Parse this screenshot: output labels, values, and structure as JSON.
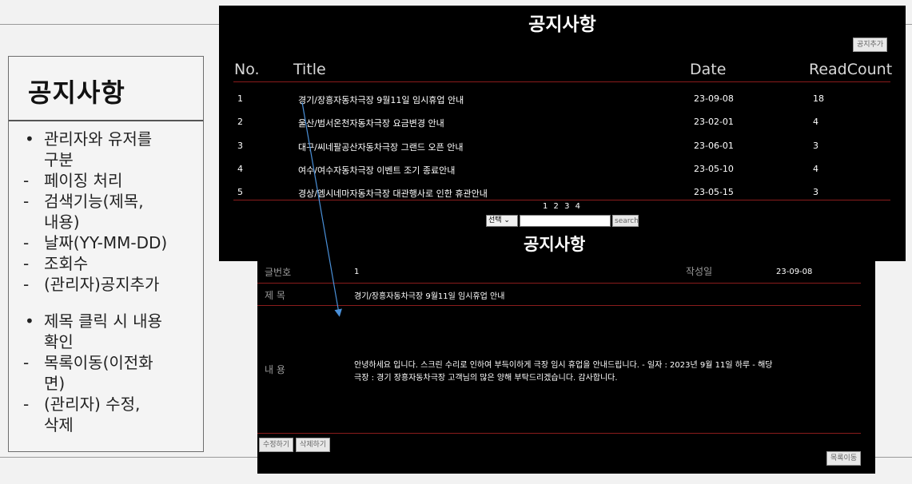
{
  "note": {
    "title": "공지사항",
    "items": [
      {
        "type": "bullet",
        "text": "관리자와 유저를"
      },
      {
        "type": "cont",
        "text": "구분"
      },
      {
        "type": "dash",
        "text": "페이징 처리"
      },
      {
        "type": "dash",
        "text": "검색기능(제목,"
      },
      {
        "type": "cont",
        "text": "내용)"
      },
      {
        "type": "dash",
        "text": "날짜(YY-MM-DD)"
      },
      {
        "type": "dash",
        "text": "조회수"
      },
      {
        "type": "dash",
        "text": "(관리자)공지추가"
      },
      {
        "type": "gap",
        "text": ""
      },
      {
        "type": "bullet",
        "text": "제목 클릭 시 내용"
      },
      {
        "type": "cont",
        "text": "확인"
      },
      {
        "type": "dash",
        "text": "목록이동(이전화"
      },
      {
        "type": "cont",
        "text": "면)"
      },
      {
        "type": "dash",
        "text": "(관리자) 수정,"
      },
      {
        "type": "cont",
        "text": "삭제"
      }
    ]
  },
  "list": {
    "heading": "공지사항",
    "add_button": "공지추가",
    "columns": {
      "no": "No.",
      "title": "Title",
      "date": "Date",
      "readcount": "ReadCount"
    },
    "rows": [
      {
        "no": "1",
        "title": "경기/장흥자동차극장 9월11일 임시휴업 안내",
        "date": "23-09-08",
        "count": "18"
      },
      {
        "no": "2",
        "title": "울산/범서온천자동차극장 요금변경 안내",
        "date": "23-02-01",
        "count": "4"
      },
      {
        "no": "3",
        "title": "대구/씨네팔공산자동차극장 그랜드 오픈 안내",
        "date": "23-06-01",
        "count": "3"
      },
      {
        "no": "4",
        "title": "여수/여수자동차극장 이벤트 조기 종료안내",
        "date": "23-05-10",
        "count": "4"
      },
      {
        "no": "5",
        "title": "경상/엠시네마자동차극장 대관행사로 인한 휴관안내",
        "date": "23-05-15",
        "count": "3"
      }
    ],
    "pages": "1 2 3 4",
    "select_value": "선택 ⌄",
    "search_placeholder": "",
    "search_button": "search"
  },
  "detail": {
    "heading": "공지사항",
    "no_label": "글번호",
    "no_value": "1",
    "date_label": "작성일",
    "date_value": "23-09-08",
    "subject_label": "제 목",
    "subject_value": "경기/장흥자동차극장 9월11일 임시휴업 안내",
    "content_label": "내 용",
    "content_line1": "안녕하세요 입니다. 스크린 수리로 인하여 부득이하게 극장 임시 휴업을 안내드립니다. - 일자 : 2023년 9월 11일 하루 - 해당",
    "content_line2": "극장 : 경기 장흥자동차극장 고객님의 많은 양해 부탁드리겠습니다. 감사합니다.",
    "edit_button": "수정하기",
    "delete_button": "삭제하기",
    "list_button": "목록이동"
  },
  "colors": {
    "panel": "#000000",
    "divider": "#8a1c1c",
    "arrow": "#4a90d9"
  }
}
